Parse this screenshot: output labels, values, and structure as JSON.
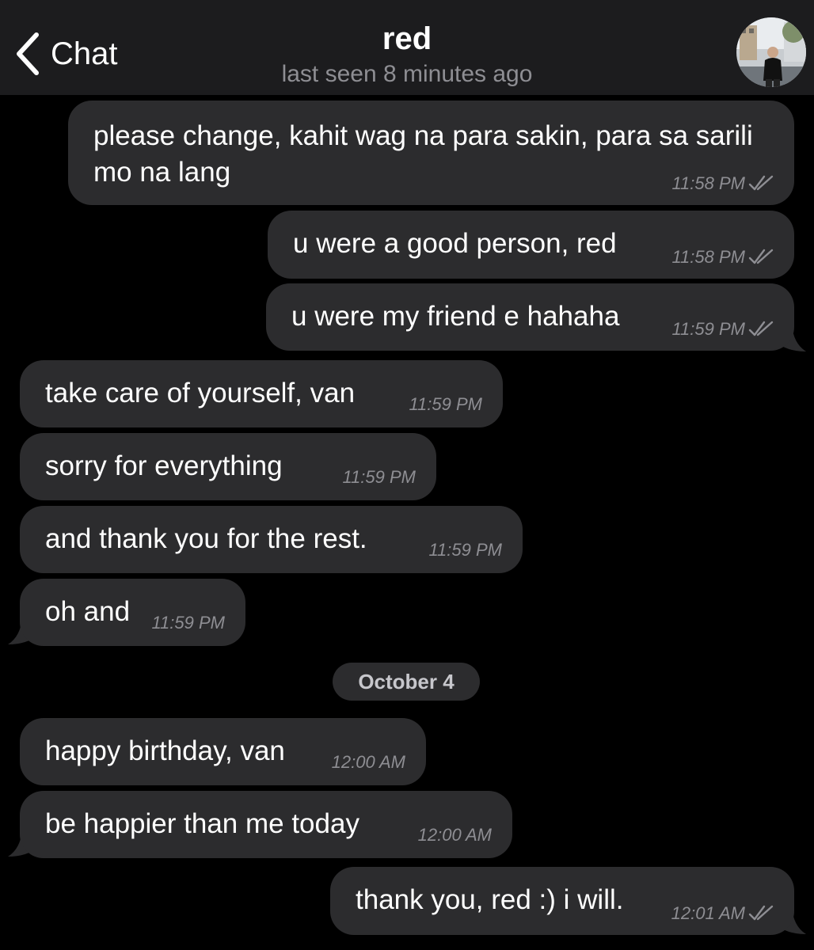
{
  "header": {
    "back_label": "Chat",
    "title": "red",
    "status": "last seen 8 minutes ago"
  },
  "messages": [
    {
      "direction": "outgoing",
      "text": "please change, kahit wag na para sakin, para sa sarili mo na lang",
      "time": "11:58 PM",
      "read": true
    },
    {
      "direction": "outgoing",
      "text": "u were a good person, red",
      "time": "11:58 PM",
      "read": true
    },
    {
      "direction": "outgoing",
      "text": "u were my friend e hahaha",
      "time": "11:59 PM",
      "read": true
    },
    {
      "direction": "incoming",
      "text": "take care of yourself, van",
      "time": "11:59 PM"
    },
    {
      "direction": "incoming",
      "text": "sorry for everything",
      "time": "11:59 PM"
    },
    {
      "direction": "incoming",
      "text": "and thank you for the rest.",
      "time": "11:59 PM"
    },
    {
      "direction": "incoming",
      "text": "oh and",
      "time": "11:59 PM"
    },
    {
      "direction": "incoming",
      "text": "happy birthday, van",
      "time": "12:00 AM"
    },
    {
      "direction": "incoming",
      "text": "be happier than me today",
      "time": "12:00 AM"
    },
    {
      "direction": "outgoing",
      "text": "thank you, red :) i will.",
      "time": "12:01 AM",
      "read": true
    }
  ],
  "date_separator": "October 4",
  "icons": {
    "back": "chevron-left-icon",
    "read_receipt": "double-check-icon",
    "avatar": "contact-avatar"
  },
  "colors": {
    "background": "#000000",
    "header": "#1c1c1e",
    "bubble": "#2c2c2e",
    "meta": "#8e8e93"
  }
}
